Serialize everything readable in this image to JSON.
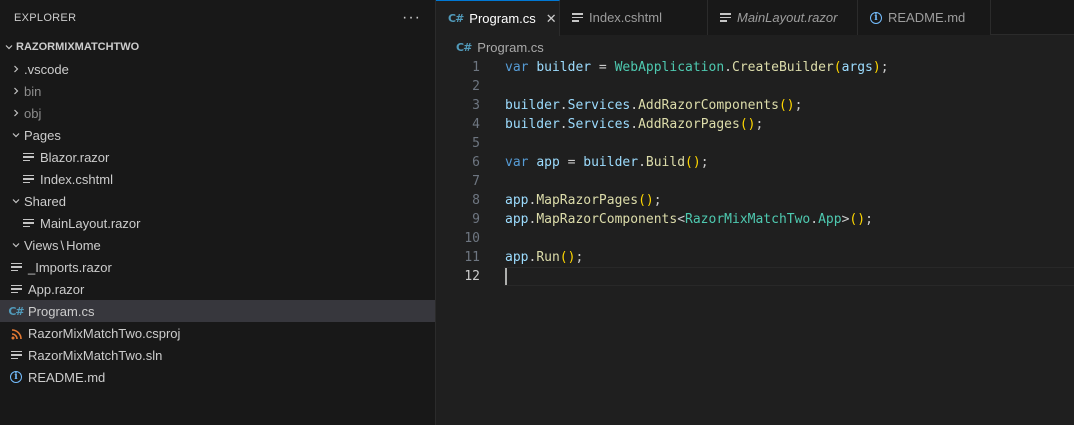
{
  "explorer": {
    "title": "EXPLORER",
    "more": "···",
    "root": "RAZORMIXMATCHTWO",
    "items": [
      {
        "type": "folder",
        "label": ".vscode",
        "open": false,
        "depth": 1,
        "dim": false
      },
      {
        "type": "folder",
        "label": "bin",
        "open": false,
        "depth": 1,
        "dim": true
      },
      {
        "type": "folder",
        "label": "obj",
        "open": false,
        "depth": 1,
        "dim": true
      },
      {
        "type": "folder",
        "label": "Pages",
        "open": true,
        "depth": 1,
        "dim": false
      },
      {
        "type": "file",
        "label": "Blazor.razor",
        "icon": "lines-icon",
        "depth": 2
      },
      {
        "type": "file",
        "label": "Index.cshtml",
        "icon": "lines-icon",
        "depth": 2
      },
      {
        "type": "folder",
        "label": "Shared",
        "open": true,
        "depth": 1,
        "dim": false
      },
      {
        "type": "file",
        "label": "MainLayout.razor",
        "icon": "lines-icon",
        "depth": 2
      },
      {
        "type": "folder",
        "label": "Views",
        "sep": "\\",
        "label2": "Home",
        "open": true,
        "depth": 1,
        "dim": false
      },
      {
        "type": "file",
        "label": "_Imports.razor",
        "icon": "lines-icon",
        "depth": 1
      },
      {
        "type": "file",
        "label": "App.razor",
        "icon": "lines-icon",
        "depth": 1
      },
      {
        "type": "file",
        "label": "Program.cs",
        "icon": "csharp-icon",
        "depth": 1,
        "selected": true
      },
      {
        "type": "file",
        "label": "RazorMixMatchTwo.csproj",
        "icon": "rss-icon",
        "depth": 1
      },
      {
        "type": "file",
        "label": "RazorMixMatchTwo.sln",
        "icon": "lines-icon",
        "depth": 1
      },
      {
        "type": "file",
        "label": "README.md",
        "icon": "info-icon",
        "depth": 1
      }
    ]
  },
  "tabs": [
    {
      "label": "Program.cs",
      "icon": "csharp-icon",
      "active": true,
      "close": "✕"
    },
    {
      "label": "Index.cshtml",
      "icon": "lines-icon",
      "active": false
    },
    {
      "label": "MainLayout.razor",
      "icon": "lines-icon",
      "active": false,
      "italic": true
    },
    {
      "label": "README.md",
      "icon": "info-icon",
      "active": false
    }
  ],
  "breadcrumb": {
    "label": "Program.cs",
    "icon": "csharp-icon"
  },
  "editor": {
    "current_line": 12,
    "lines": [
      {
        "n": "1",
        "tokens": [
          [
            "kw",
            "var"
          ],
          [
            "pn",
            " "
          ],
          [
            "vr",
            "builder"
          ],
          [
            "pn",
            " = "
          ],
          [
            "ty",
            "WebApplication"
          ],
          [
            "pn",
            "."
          ],
          [
            "fn",
            "CreateBuilder"
          ],
          [
            "br",
            "("
          ],
          [
            "vr",
            "args"
          ],
          [
            "br",
            ")"
          ],
          [
            "pn",
            ";"
          ]
        ]
      },
      {
        "n": "2",
        "tokens": []
      },
      {
        "n": "3",
        "tokens": [
          [
            "vr",
            "builder"
          ],
          [
            "pn",
            "."
          ],
          [
            "vr",
            "Services"
          ],
          [
            "pn",
            "."
          ],
          [
            "fn",
            "AddRazorComponents"
          ],
          [
            "br",
            "()"
          ],
          [
            "pn",
            ";"
          ]
        ]
      },
      {
        "n": "4",
        "tokens": [
          [
            "vr",
            "builder"
          ],
          [
            "pn",
            "."
          ],
          [
            "vr",
            "Services"
          ],
          [
            "pn",
            "."
          ],
          [
            "fn",
            "AddRazorPages"
          ],
          [
            "br",
            "()"
          ],
          [
            "pn",
            ";"
          ]
        ]
      },
      {
        "n": "5",
        "tokens": []
      },
      {
        "n": "6",
        "tokens": [
          [
            "kw",
            "var"
          ],
          [
            "pn",
            " "
          ],
          [
            "vr",
            "app"
          ],
          [
            "pn",
            " = "
          ],
          [
            "vr",
            "builder"
          ],
          [
            "pn",
            "."
          ],
          [
            "fn",
            "Build"
          ],
          [
            "br",
            "()"
          ],
          [
            "pn",
            ";"
          ]
        ]
      },
      {
        "n": "7",
        "tokens": []
      },
      {
        "n": "8",
        "tokens": [
          [
            "vr",
            "app"
          ],
          [
            "pn",
            "."
          ],
          [
            "fn",
            "MapRazorPages"
          ],
          [
            "br",
            "()"
          ],
          [
            "pn",
            ";"
          ]
        ]
      },
      {
        "n": "9",
        "tokens": [
          [
            "vr",
            "app"
          ],
          [
            "pn",
            "."
          ],
          [
            "fn",
            "MapRazorComponents"
          ],
          [
            "pn",
            "<"
          ],
          [
            "ty",
            "RazorMixMatchTwo"
          ],
          [
            "pn",
            "."
          ],
          [
            "ty",
            "App"
          ],
          [
            "pn",
            ">"
          ],
          [
            "br",
            "()"
          ],
          [
            "pn",
            ";"
          ]
        ]
      },
      {
        "n": "10",
        "tokens": []
      },
      {
        "n": "11",
        "tokens": [
          [
            "vr",
            "app"
          ],
          [
            "pn",
            "."
          ],
          [
            "fn",
            "Run"
          ],
          [
            "br",
            "()"
          ],
          [
            "pn",
            ";"
          ]
        ]
      },
      {
        "n": "12",
        "tokens": []
      }
    ]
  },
  "colors": {
    "accent": "#0078d4",
    "selection": "#37373d",
    "csharp": "#519aba",
    "rss": "#e37933",
    "info": "#75beff"
  }
}
